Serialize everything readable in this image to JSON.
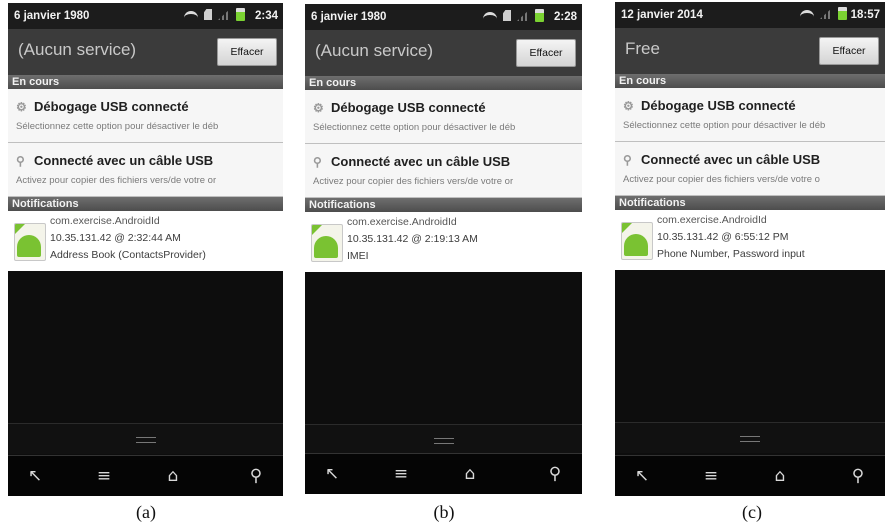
{
  "colors": {
    "notification_bg": "#ffffff",
    "header_bg": "#3b3b3b",
    "screen_bg": "#0d0d0d",
    "android_green": "#7ac232"
  },
  "icons": [
    "wifi-icon",
    "sim-icon",
    "signal-icon",
    "battery-icon",
    "usb-debug-icon",
    "usb-icon",
    "android-app-icon",
    "back-icon",
    "menu-icon",
    "home-icon",
    "search-icon"
  ],
  "nav": {
    "back": "↖",
    "menu": "≡",
    "home": "⌂",
    "search": "⚲"
  },
  "phones": [
    {
      "status_date": "6 janvier 1980",
      "status_time": "2:34",
      "carrier": "(Aucun service)",
      "clear_label": "Effacer",
      "ongoing_label": "En cours",
      "notifications_label": "Notifications",
      "usb_debug_title": "Débogage USB connecté",
      "usb_debug_sub": "Sélectionnez cette option pour désactiver le déb",
      "usb_cable_title": "Connecté avec un câble USB",
      "usb_cable_sub": "Activez pour copier des fichiers vers/de votre or",
      "notif_app": "com.exercise.AndroidId",
      "notif_time": "10.35.131.42 @ 2:32:44 AM",
      "notif_text": "Address Book (ContactsProvider)",
      "caption": "(a)"
    },
    {
      "status_date": "6 janvier 1980",
      "status_time": "2:28",
      "carrier": "(Aucun service)",
      "clear_label": "Effacer",
      "ongoing_label": "En cours",
      "notifications_label": "Notifications",
      "usb_debug_title": "Débogage USB connecté",
      "usb_debug_sub": "Sélectionnez cette option pour désactiver le déb",
      "usb_cable_title": "Connecté avec un câble USB",
      "usb_cable_sub": "Activez pour copier des fichiers vers/de votre or",
      "notif_app": "com.exercise.AndroidId",
      "notif_time": "10.35.131.42 @ 2:19:13 AM",
      "notif_text": "IMEI",
      "caption": "(b)"
    },
    {
      "status_date": "12 janvier 2014",
      "status_time": "18:57",
      "carrier": "Free",
      "clear_label": "Effacer",
      "ongoing_label": "En cours",
      "notifications_label": "Notifications",
      "usb_debug_title": "Débogage USB connecté",
      "usb_debug_sub": "Sélectionnez cette option pour désactiver le déb",
      "usb_cable_title": "Connecté avec un câble USB",
      "usb_cable_sub": "Activez pour copier des fichiers vers/de votre o",
      "notif_app": "com.exercise.AndroidId",
      "notif_time": "10.35.131.42 @ 6:55:12 PM",
      "notif_text": "Phone Number, Password input",
      "caption": "(c)"
    }
  ]
}
